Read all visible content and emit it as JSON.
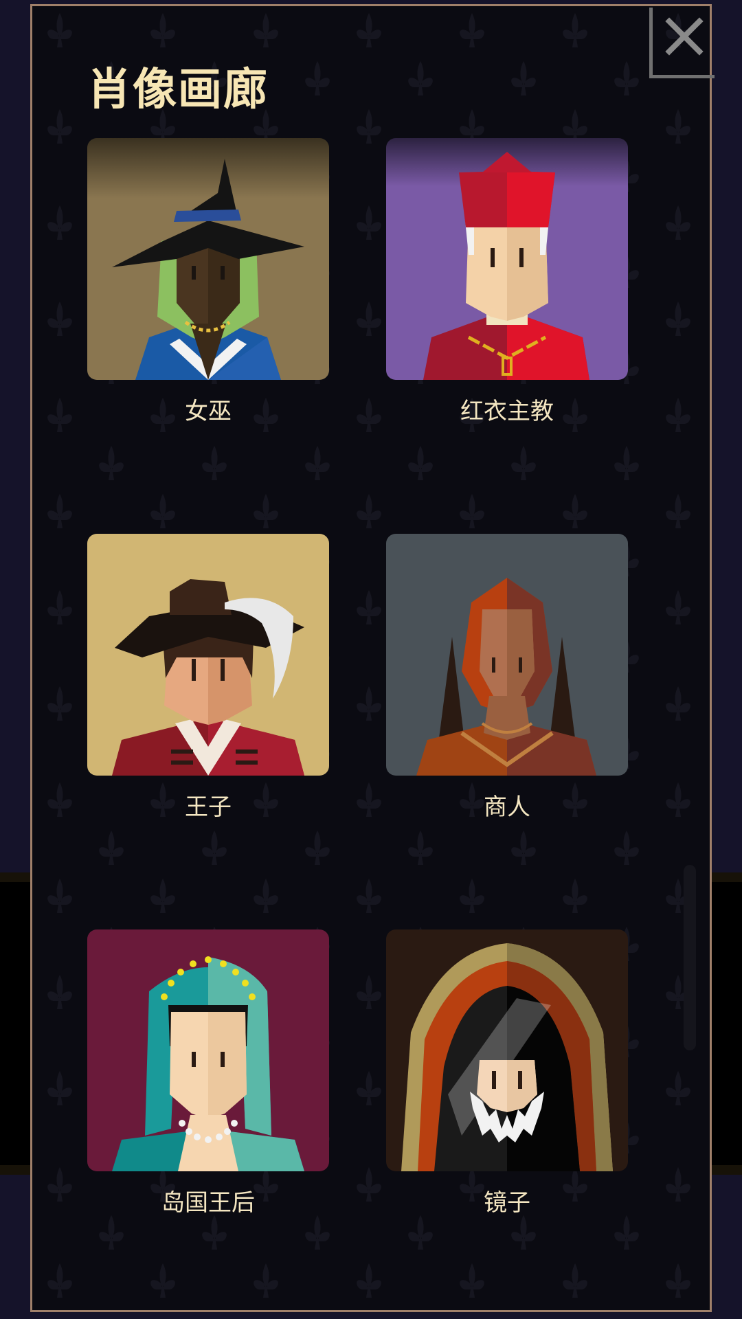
{
  "gallery": {
    "title": "肖像画廊",
    "close_icon": "close-icon",
    "portraits": [
      {
        "label": "女巫",
        "icon": "witch-portrait",
        "bg": "#8a7650"
      },
      {
        "label": "红衣主教",
        "icon": "cardinal-portrait",
        "bg": "#7a5aa6"
      },
      {
        "label": "王子",
        "icon": "prince-portrait",
        "bg": "#d1b673"
      },
      {
        "label": "商人",
        "icon": "merchant-portrait",
        "bg": "#4a5258"
      },
      {
        "label": "岛国王后",
        "icon": "island-queen-portrait",
        "bg": "#6a1a3a"
      },
      {
        "label": "镜子",
        "icon": "mirror-portrait",
        "bg": "#2a1a12"
      }
    ]
  },
  "colors": {
    "title": "#f7e6b4",
    "frame": "#a0806a",
    "panel_bg": "#0b0b12"
  }
}
